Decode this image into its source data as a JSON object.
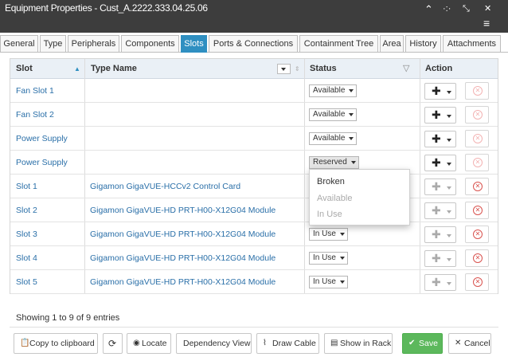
{
  "window": {
    "title": "Equipment Properties - Cust_A.2222.333.04.25.06",
    "controls": {
      "collapse": "⌃",
      "dots": "·:·",
      "compress": "⤡",
      "close": "✕",
      "menu": "≡"
    }
  },
  "tabs": [
    {
      "label": "General"
    },
    {
      "label": "Type"
    },
    {
      "label": "Peripherals"
    },
    {
      "label": "Components"
    },
    {
      "label": "Slots",
      "active": true
    },
    {
      "label": "Ports & Connections"
    },
    {
      "label": "Containment Tree"
    },
    {
      "label": "Area"
    },
    {
      "label": "History"
    },
    {
      "label": "Attachments"
    }
  ],
  "grid": {
    "headers": {
      "slot": "Slot",
      "type": "Type Name",
      "status": "Status",
      "action": "Action"
    },
    "rows": [
      {
        "slot": "Fan Slot 1",
        "type": "",
        "status": "Available"
      },
      {
        "slot": "Fan Slot 2",
        "type": "",
        "status": "Available"
      },
      {
        "slot": "Power Supply",
        "type": "",
        "status": "Available"
      },
      {
        "slot": "Power Supply",
        "type": "",
        "status": "Reserved"
      },
      {
        "slot": "Slot 1",
        "type": "Gigamon GigaVUE-HCCv2 Control Card",
        "status": ""
      },
      {
        "slot": "Slot 2",
        "type": "Gigamon GigaVUE-HD PRT-H00-X12G04 Module",
        "status": ""
      },
      {
        "slot": "Slot 3",
        "type": "Gigamon GigaVUE-HD PRT-H00-X12G04 Module",
        "status": "In Use"
      },
      {
        "slot": "Slot 4",
        "type": "Gigamon GigaVUE-HD PRT-H00-X12G04 Module",
        "status": "In Use"
      },
      {
        "slot": "Slot 5",
        "type": "Gigamon GigaVUE-HD PRT-H00-X12G04 Module",
        "status": "In Use"
      }
    ],
    "info": "Showing 1 to 9 of 9 entries"
  },
  "status_dropdown": {
    "options": [
      {
        "label": "Broken",
        "enabled": true
      },
      {
        "label": "Available",
        "enabled": false
      },
      {
        "label": "In Use",
        "enabled": false
      }
    ]
  },
  "buttons": {
    "copy": "Copy to clipboard",
    "refresh_icon": "refresh-icon",
    "locate": "Locate",
    "dependency": "Dependency View",
    "draw_cable": "Draw Cable",
    "show_rack": "Show in Rack",
    "save": "Save",
    "cancel": "Cancel"
  },
  "colors": {
    "accent": "#2f8fc1",
    "save": "#5cb85c",
    "link": "#2a6fa8",
    "delete": "#d9534f"
  }
}
